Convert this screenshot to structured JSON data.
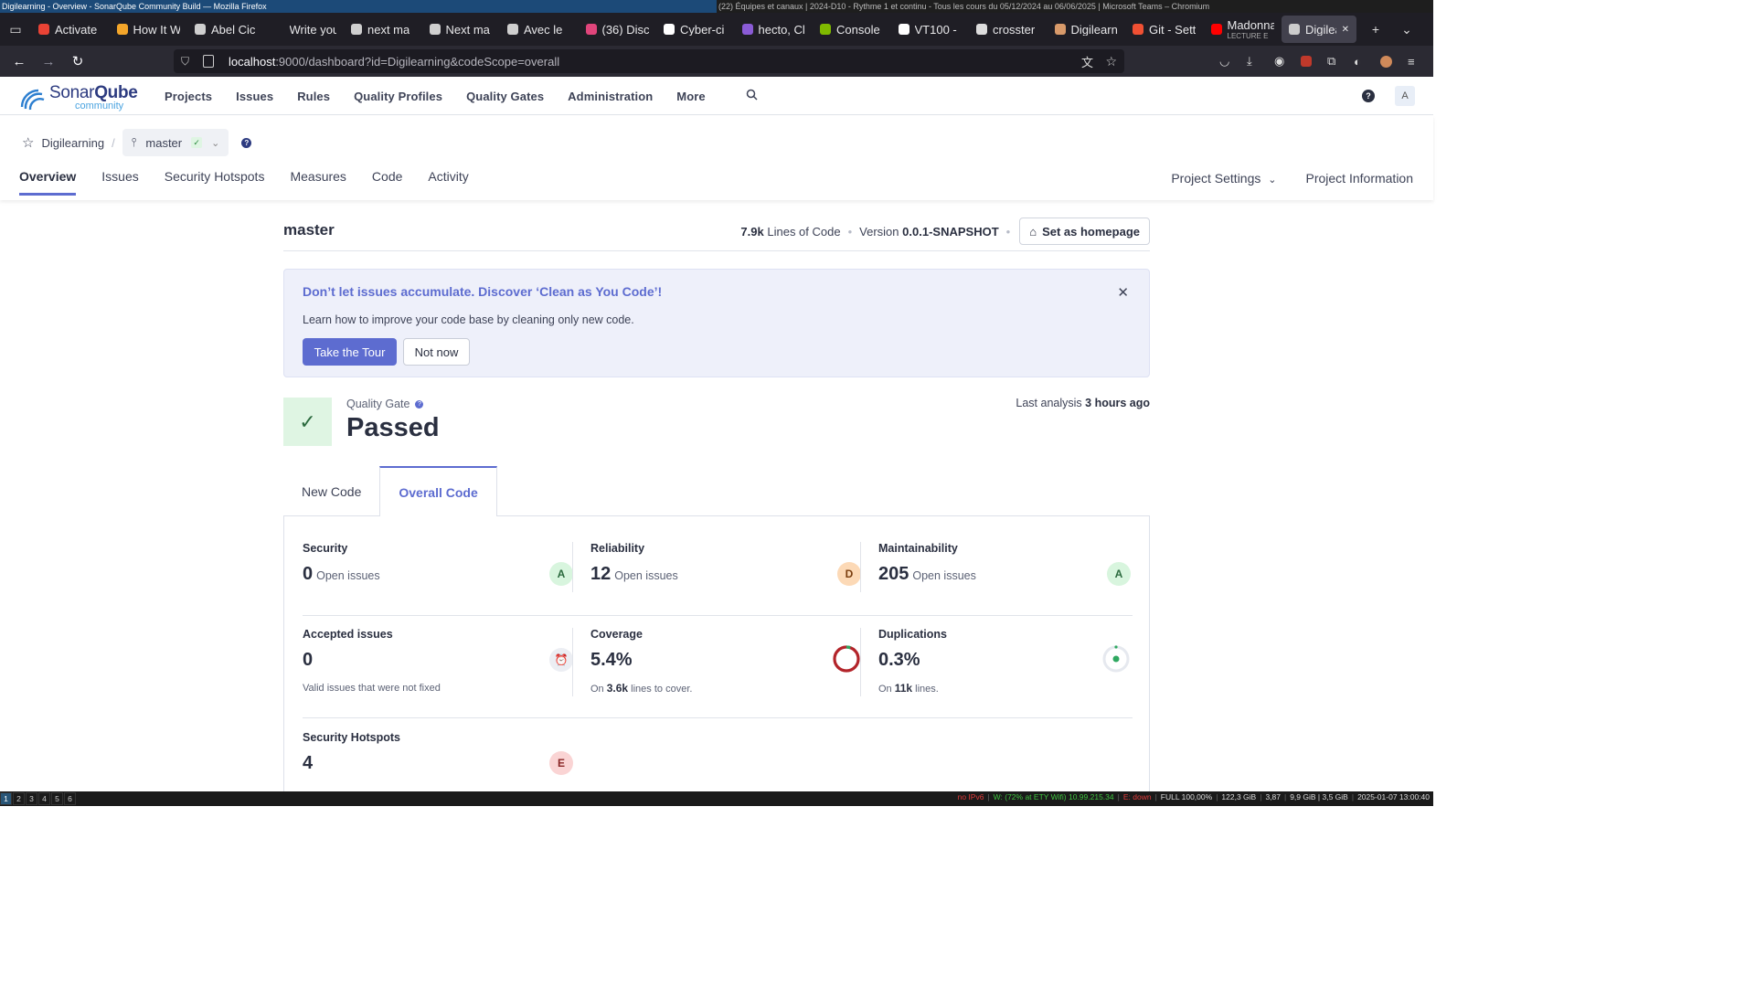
{
  "wm": {
    "left_title": "Digilearning - Overview - SonarQube Community Build — Mozilla Firefox",
    "right_title": "(22) Équipes et canaux | 2024-D10 - Rythme 1 et continu - Tous les cours du 05/12/2024 au 06/06/2025 | Microsoft Teams – Chromium"
  },
  "browser": {
    "tabs": [
      {
        "label": "Activate",
        "icon": "gmail-icon",
        "color": "#ea4335"
      },
      {
        "label": "How It W",
        "icon": "box-icon",
        "color": "#f4a62a"
      },
      {
        "label": "Abel Cic",
        "icon": "quill-icon",
        "color": "#cfcfcf"
      },
      {
        "label": "Write your",
        "icon": "none",
        "color": "#1f1e25"
      },
      {
        "label": "next ma",
        "icon": "n-icon",
        "color": "#cfcfcf"
      },
      {
        "label": "Next ma",
        "icon": "n-icon",
        "color": "#cfcfcf"
      },
      {
        "label": "Avec le",
        "icon": "n-icon",
        "color": "#cfcfcf"
      },
      {
        "label": "(36) Disc",
        "icon": "discord-icon",
        "color": "#e0457b"
      },
      {
        "label": "Cyber-ci",
        "icon": "github-icon",
        "color": "#fff"
      },
      {
        "label": "hecto, Cl",
        "icon": "twitch-icon",
        "color": "#8a5bd6"
      },
      {
        "label": "Console",
        "icon": "microsoft-icon",
        "color": "#7fba00"
      },
      {
        "label": "VT100 -",
        "icon": "wikipedia-icon",
        "color": "#fff"
      },
      {
        "label": "crosster",
        "icon": "circle-icon",
        "color": "#ddd"
      },
      {
        "label": "Digilearn",
        "icon": "avatar-icon",
        "color": "#d89a6a"
      },
      {
        "label": "Git - Sett",
        "icon": "git-icon",
        "color": "#f05033"
      },
      {
        "label": "Madonna",
        "icon": "youtube-icon",
        "color": "#ff0000",
        "sub": "LECTURE E"
      },
      {
        "label": "Digilea",
        "icon": "globe-icon",
        "color": "#ccc",
        "active": true
      }
    ],
    "url_host": "localhost",
    "url_rest": ":9000/dashboard?id=Digilearning&codeScope=overall"
  },
  "header": {
    "logo_sonar": "Sonar",
    "logo_qube": "Qube",
    "logo_sub": "community",
    "nav": [
      "Projects",
      "Issues",
      "Rules",
      "Quality Profiles",
      "Quality Gates",
      "Administration",
      "More"
    ],
    "avatar": "A"
  },
  "project": {
    "name": "Digilearning",
    "branch": "master",
    "tabs": [
      "Overview",
      "Issues",
      "Security Hotspots",
      "Measures",
      "Code",
      "Activity"
    ],
    "settings": "Project Settings",
    "info": "Project Information"
  },
  "overview": {
    "branch_title": "master",
    "loc": "7.9k",
    "loc_label": "Lines of Code",
    "version_label": "Version",
    "version": "0.0.1-SNAPSHOT",
    "home_btn": "Set as homepage",
    "banner_title": "Don’t let issues accumulate. Discover ‘Clean as You Code’!",
    "banner_desc": "Learn how to improve your code base by cleaning only new code.",
    "tour_btn": "Take the Tour",
    "notnow_btn": "Not now",
    "qg_label": "Quality Gate",
    "qg_status": "Passed",
    "last_label": "Last analysis",
    "last_value": "3 hours ago",
    "tab_new": "New Code",
    "tab_overall": "Overall Code"
  },
  "metrics": {
    "security": {
      "title": "Security",
      "value": "0",
      "unit": "Open issues",
      "grade": "A"
    },
    "reliability": {
      "title": "Reliability",
      "value": "12",
      "unit": "Open issues",
      "grade": "D"
    },
    "maintainability": {
      "title": "Maintainability",
      "value": "205",
      "unit": "Open issues",
      "grade": "A"
    },
    "accepted": {
      "title": "Accepted issues",
      "value": "0",
      "sub": "Valid issues that were not fixed"
    },
    "coverage": {
      "title": "Coverage",
      "value": "5.4%",
      "sub_pre": "On",
      "sub_num": "3.6k",
      "sub_post": "lines to cover."
    },
    "duplications": {
      "title": "Duplications",
      "value": "0.3%",
      "sub_pre": "On",
      "sub_num": "11k",
      "sub_post": "lines."
    },
    "hotspots": {
      "title": "Security Hotspots",
      "value": "4",
      "grade": "E"
    }
  },
  "statusbar": {
    "workspaces": [
      "1",
      "2",
      "3",
      "4",
      "5",
      "6"
    ],
    "ipv6": "no IPv6",
    "wifi": "W: (72% at ETY Wifi) 10.99.215.34",
    "eth": "E: down",
    "bat": "FULL 100,00%",
    "disk": "122,3 GiB",
    "load": "3,87",
    "mem": "9,9 GiB | 3,5 GiB",
    "time": "2025-01-07 13:00:40"
  }
}
